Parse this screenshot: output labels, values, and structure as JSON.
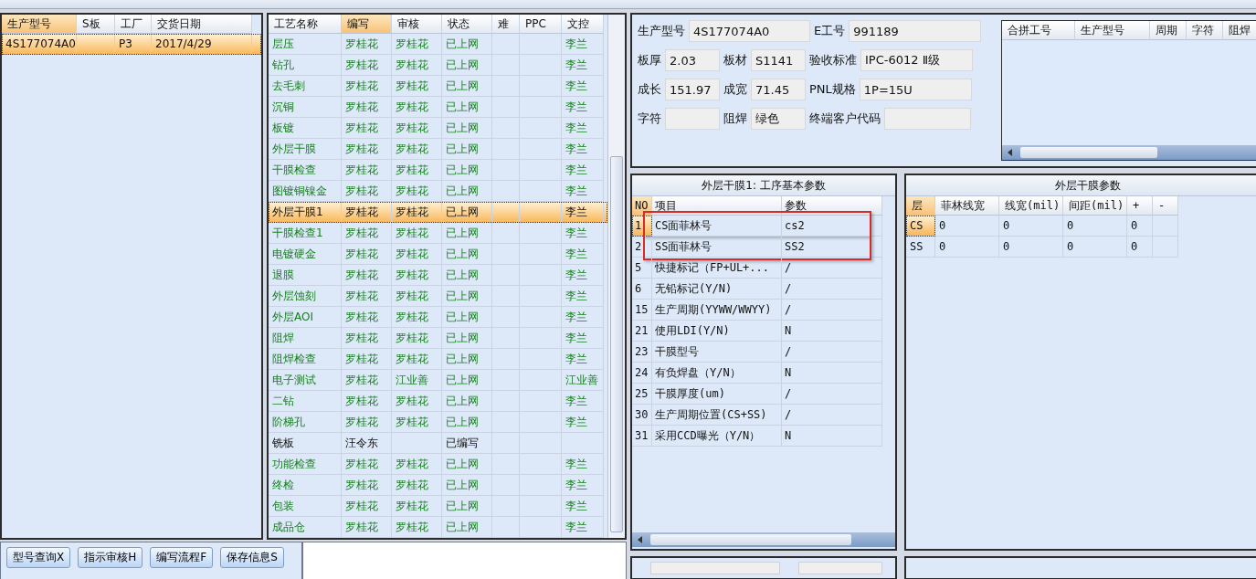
{
  "orders": {
    "columns": [
      {
        "label": "生产型号",
        "sorted": true
      },
      {
        "label": "S板",
        "sorted": false
      },
      {
        "label": "工厂",
        "sorted": false
      },
      {
        "label": "交货日期",
        "sorted": false
      }
    ],
    "rows": [
      {
        "selected": true,
        "cells": [
          "4S177074A0",
          "",
          "P3",
          "2017/4/29"
        ]
      }
    ]
  },
  "process": {
    "columns": [
      {
        "label": "工艺名称",
        "sorted": false
      },
      {
        "label": "编写",
        "sorted": true
      },
      {
        "label": "审核",
        "sorted": false
      },
      {
        "label": "状态",
        "sorted": false
      },
      {
        "label": "难",
        "sorted": false
      },
      {
        "label": "PPC",
        "sorted": false
      },
      {
        "label": "文控",
        "sorted": false
      }
    ],
    "rows": [
      {
        "kind": "online",
        "selected": false,
        "cells": [
          "层压",
          "罗桂花",
          "罗桂花",
          "已上网",
          "",
          "",
          "李兰"
        ]
      },
      {
        "kind": "online",
        "selected": false,
        "cells": [
          "钻孔",
          "罗桂花",
          "罗桂花",
          "已上网",
          "",
          "",
          "李兰"
        ]
      },
      {
        "kind": "online",
        "selected": false,
        "cells": [
          "去毛刺",
          "罗桂花",
          "罗桂花",
          "已上网",
          "",
          "",
          "李兰"
        ]
      },
      {
        "kind": "online",
        "selected": false,
        "cells": [
          "沉铜",
          "罗桂花",
          "罗桂花",
          "已上网",
          "",
          "",
          "李兰"
        ]
      },
      {
        "kind": "online",
        "selected": false,
        "cells": [
          "板镀",
          "罗桂花",
          "罗桂花",
          "已上网",
          "",
          "",
          "李兰"
        ]
      },
      {
        "kind": "online",
        "selected": false,
        "cells": [
          "外层干膜",
          "罗桂花",
          "罗桂花",
          "已上网",
          "",
          "",
          "李兰"
        ]
      },
      {
        "kind": "online",
        "selected": false,
        "cells": [
          "干膜检查",
          "罗桂花",
          "罗桂花",
          "已上网",
          "",
          "",
          "李兰"
        ]
      },
      {
        "kind": "online",
        "selected": false,
        "cells": [
          "图镀铜镍金",
          "罗桂花",
          "罗桂花",
          "已上网",
          "",
          "",
          "李兰"
        ]
      },
      {
        "kind": "online",
        "selected": true,
        "cells": [
          "外层干膜1",
          "罗桂花",
          "罗桂花",
          "已上网",
          "",
          "",
          "李兰"
        ]
      },
      {
        "kind": "online",
        "selected": false,
        "cells": [
          "干膜检查1",
          "罗桂花",
          "罗桂花",
          "已上网",
          "",
          "",
          "李兰"
        ]
      },
      {
        "kind": "online",
        "selected": false,
        "cells": [
          "电镀硬金",
          "罗桂花",
          "罗桂花",
          "已上网",
          "",
          "",
          "李兰"
        ]
      },
      {
        "kind": "online",
        "selected": false,
        "cells": [
          "退膜",
          "罗桂花",
          "罗桂花",
          "已上网",
          "",
          "",
          "李兰"
        ]
      },
      {
        "kind": "online",
        "selected": false,
        "cells": [
          "外层蚀刻",
          "罗桂花",
          "罗桂花",
          "已上网",
          "",
          "",
          "李兰"
        ]
      },
      {
        "kind": "online",
        "selected": false,
        "cells": [
          "外层AOI",
          "罗桂花",
          "罗桂花",
          "已上网",
          "",
          "",
          "李兰"
        ]
      },
      {
        "kind": "online",
        "selected": false,
        "cells": [
          "阻焊",
          "罗桂花",
          "罗桂花",
          "已上网",
          "",
          "",
          "李兰"
        ]
      },
      {
        "kind": "online",
        "selected": false,
        "cells": [
          "阻焊检查",
          "罗桂花",
          "罗桂花",
          "已上网",
          "",
          "",
          "李兰"
        ]
      },
      {
        "kind": "online",
        "selected": false,
        "cells": [
          "电子测试",
          "罗桂花",
          "江业善",
          "已上网",
          "",
          "",
          "江业善"
        ]
      },
      {
        "kind": "online",
        "selected": false,
        "cells": [
          "二钻",
          "罗桂花",
          "罗桂花",
          "已上网",
          "",
          "",
          "李兰"
        ]
      },
      {
        "kind": "online",
        "selected": false,
        "cells": [
          "阶梯孔",
          "罗桂花",
          "罗桂花",
          "已上网",
          "",
          "",
          "李兰"
        ]
      },
      {
        "kind": "draft",
        "selected": false,
        "cells": [
          "铣板",
          "汪令东",
          "",
          "已编写",
          "",
          "",
          ""
        ]
      },
      {
        "kind": "online",
        "selected": false,
        "cells": [
          "功能检查",
          "罗桂花",
          "罗桂花",
          "已上网",
          "",
          "",
          "李兰"
        ]
      },
      {
        "kind": "online",
        "selected": false,
        "cells": [
          "终检",
          "罗桂花",
          "罗桂花",
          "已上网",
          "",
          "",
          "李兰"
        ]
      },
      {
        "kind": "online",
        "selected": false,
        "cells": [
          "包装",
          "罗桂花",
          "罗桂花",
          "已上网",
          "",
          "",
          "李兰"
        ]
      },
      {
        "kind": "online",
        "selected": false,
        "cells": [
          "成品仓",
          "罗桂花",
          "罗桂花",
          "已上网",
          "",
          "",
          "李兰"
        ]
      }
    ]
  },
  "buttons": [
    "型号查询X",
    "指示审核H",
    "编写流程F",
    "保存信息S"
  ],
  "info": {
    "fields": [
      {
        "label": "生产型号",
        "value": "4S177074A0"
      },
      {
        "label": "E工号",
        "value": "991189"
      },
      {
        "label": "板厚",
        "value": "2.03"
      },
      {
        "label": "板材",
        "value": "S1141"
      },
      {
        "label": "验收标准",
        "value": "IPC-6012 Ⅱ级"
      },
      {
        "label": "成长",
        "value": "151.97"
      },
      {
        "label": "成宽",
        "value": "71.45"
      },
      {
        "label": "PNL规格",
        "value": "1P=15U"
      },
      {
        "label": "字符"
      },
      {
        "label": "阻焊",
        "value": "绿色"
      },
      {
        "label": "终端客户代码"
      }
    ]
  },
  "merge": {
    "columns": [
      "合拼工号",
      "生产型号",
      "周期",
      "字符",
      "阻焊"
    ]
  },
  "params": {
    "title": "外层干膜1: 工序基本参数",
    "columns": [
      "NO",
      "项目",
      "参数"
    ],
    "rows": [
      {
        "selected": true,
        "highlighted": true,
        "cells": [
          "1",
          "CS面菲林号",
          "cs2"
        ]
      },
      {
        "selected": false,
        "highlighted": true,
        "cells": [
          "2",
          "SS面菲林号",
          "SS2"
        ]
      },
      {
        "selected": false,
        "highlighted": false,
        "cells": [
          "5",
          "快捷标记（FP+UL+...",
          "/"
        ]
      },
      {
        "selected": false,
        "highlighted": false,
        "cells": [
          "6",
          "无铅标记(Y/N)",
          "/"
        ]
      },
      {
        "selected": false,
        "highlighted": false,
        "cells": [
          "15",
          "生产周期(YYWW/WWYY)",
          "/"
        ]
      },
      {
        "selected": false,
        "highlighted": false,
        "cells": [
          "21",
          "使用LDI(Y/N)",
          "N"
        ]
      },
      {
        "selected": false,
        "highlighted": false,
        "cells": [
          "23",
          "干膜型号",
          "/"
        ]
      },
      {
        "selected": false,
        "highlighted": false,
        "cells": [
          "24",
          "有负焊盘（Y/N）",
          "N"
        ]
      },
      {
        "selected": false,
        "highlighted": false,
        "cells": [
          "25",
          "干膜厚度(um)",
          "/"
        ]
      },
      {
        "selected": false,
        "highlighted": false,
        "cells": [
          "30",
          "生产周期位置(CS+SS)",
          "/"
        ]
      },
      {
        "selected": false,
        "highlighted": false,
        "cells": [
          "31",
          "采用CCD曝光（Y/N）",
          "N"
        ]
      }
    ]
  },
  "layers": {
    "title": "外层干膜参数",
    "columns": [
      "层",
      "菲林线宽",
      "线宽(mil)",
      "间距(mil)",
      "+",
      "-"
    ],
    "rows": [
      {
        "selected": true,
        "cells": [
          "CS",
          "0",
          "0",
          "0",
          "0",
          ""
        ]
      },
      {
        "selected": false,
        "cells": [
          "SS",
          "0",
          "0",
          "0",
          "0",
          ""
        ]
      }
    ]
  }
}
